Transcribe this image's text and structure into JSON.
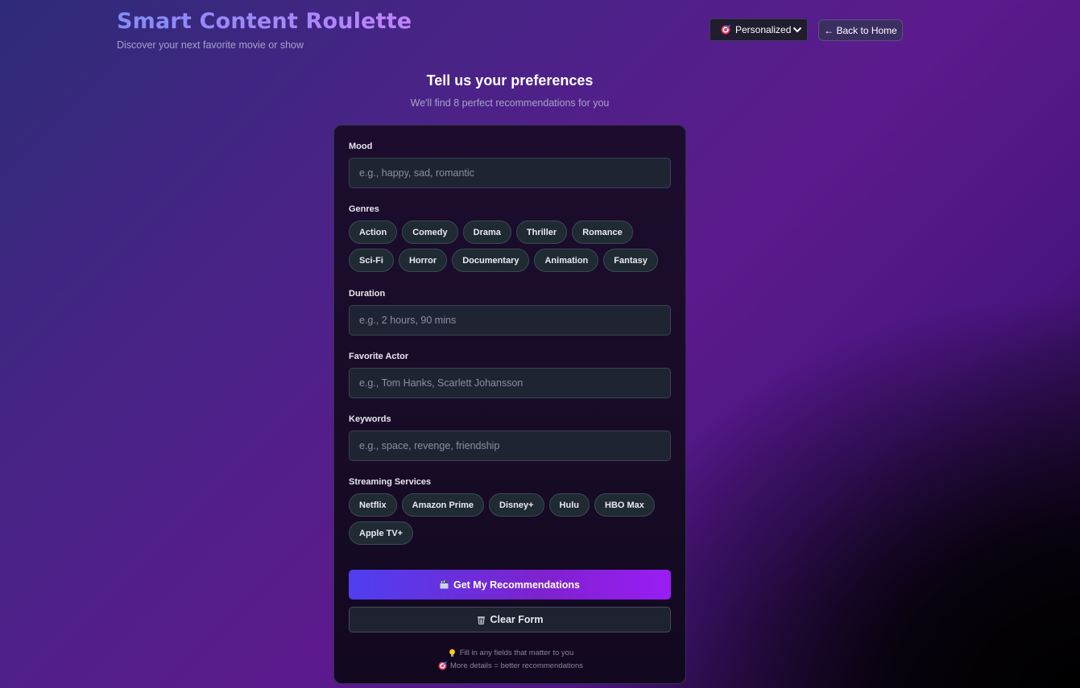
{
  "header": {
    "title": "Smart Content Roulette",
    "subtitle": "Discover your next favorite movie or show",
    "mode_select": {
      "icon": "dart-target-icon",
      "value": "Personalized"
    },
    "back_button": "← Back to Home"
  },
  "intro": {
    "title": "Tell us your preferences",
    "subtitle": "We'll find 8 perfect recommendations for you"
  },
  "form": {
    "mood": {
      "label": "Mood",
      "value": "",
      "placeholder": "e.g., happy, sad, romantic"
    },
    "genres": {
      "label": "Genres",
      "options": [
        "Action",
        "Comedy",
        "Drama",
        "Thriller",
        "Romance",
        "Sci-Fi",
        "Horror",
        "Documentary",
        "Animation",
        "Fantasy"
      ]
    },
    "duration": {
      "label": "Duration",
      "value": "",
      "placeholder": "e.g., 2 hours, 90 mins"
    },
    "actor": {
      "label": "Favorite Actor",
      "value": "",
      "placeholder": "e.g., Tom Hanks, Scarlett Johansson"
    },
    "keywords": {
      "label": "Keywords",
      "value": "",
      "placeholder": "e.g., space, revenge, friendship"
    },
    "services": {
      "label": "Streaming Services",
      "options": [
        "Netflix",
        "Amazon Prime",
        "Disney+",
        "Hulu",
        "HBO Max",
        "Apple TV+"
      ]
    },
    "submit": {
      "icon": "clapperboard-icon",
      "label": "Get My Recommendations"
    },
    "clear": {
      "icon": "trash-icon",
      "label": "Clear Form"
    },
    "tips": [
      {
        "icon": "lightbulb-icon",
        "text": "Fill in any fields that matter to you"
      },
      {
        "icon": "dart-target-icon",
        "text": "More details = better recommendations"
      }
    ]
  },
  "colors": {
    "accent_start": "#4f3ff0",
    "accent_end": "#9a1df5",
    "title_gradient_start": "#818cf8",
    "title_gradient_end": "#c084fc"
  }
}
